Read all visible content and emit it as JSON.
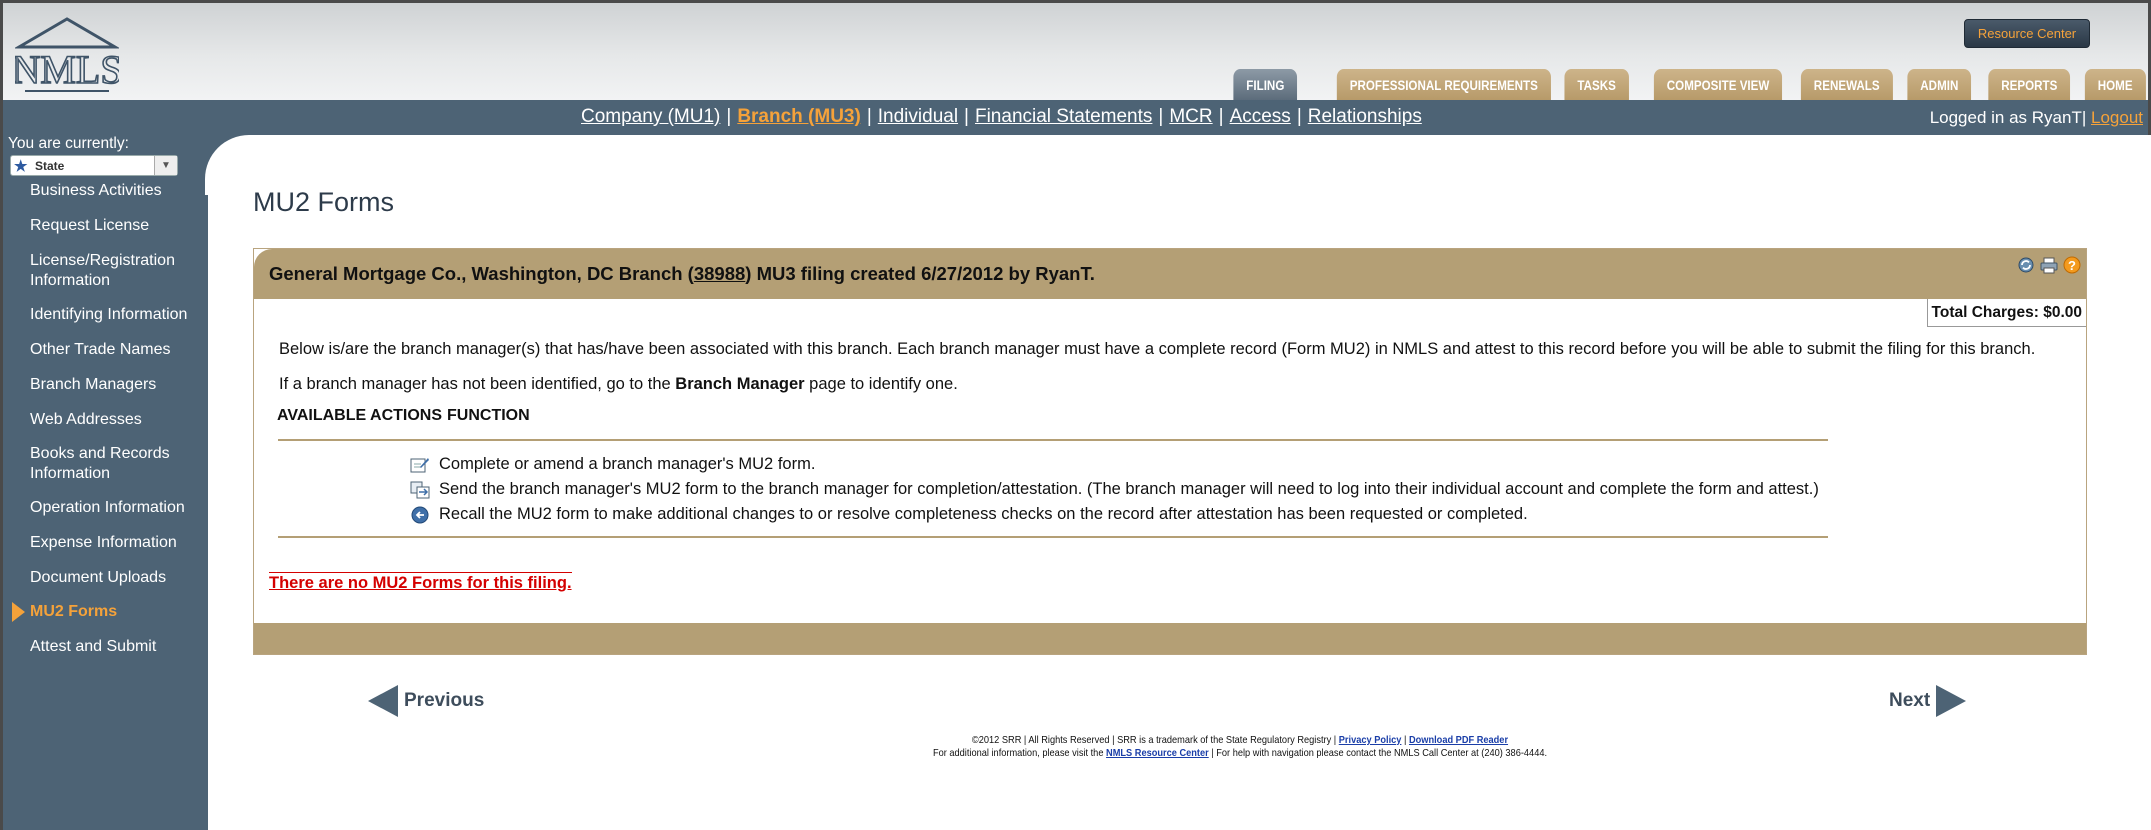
{
  "header": {
    "logo_text": "NMLS",
    "resource_center": "Resource Center",
    "tabs": [
      "FILING",
      "PROFESSIONAL REQUIREMENTS",
      "TASKS",
      "COMPOSITE VIEW",
      "RENEWALS",
      "ADMIN",
      "REPORTS",
      "HOME"
    ],
    "active_tab": "FILING"
  },
  "nav": {
    "links": [
      "Company (MU1)",
      "Branch (MU3)",
      "Individual",
      "Financial Statements",
      "MCR",
      "Access",
      "Relationships"
    ],
    "current": "Branch (MU3)",
    "separator": "|",
    "logged_in": "Logged in as RyanT",
    "logout": "Logout"
  },
  "sidebar": {
    "you_are": "You are currently:",
    "state_label": "State",
    "items": [
      "Business Activities",
      "Request License",
      "License/Registration Information",
      "Identifying Information",
      "Other Trade Names",
      "Branch Managers",
      "Web Addresses",
      "Books and Records Information",
      "Operation Information",
      "Expense Information",
      "Document Uploads",
      "MU2 Forms",
      "Attest and Submit"
    ],
    "active_item": "MU2 Forms"
  },
  "main": {
    "title": "MU2 Forms",
    "filing_prefix": "General Mortgage Co., Washington, DC Branch (",
    "filing_id": "38988",
    "filing_suffix": ") MU3 filing created 6/27/2012 by RyanT.",
    "total_charges": "Total Charges: $0.00",
    "para1": "Below is/are the branch manager(s) that has/have been associated with this branch. Each branch manager must have a complete record (Form MU2) in NMLS and attest to this record before you will be able to submit the filing for this branch.",
    "para2_prefix": "If a branch manager has not been identified, go to the ",
    "para2_bold": "Branch Manager",
    "para2_suffix": " page to identify one.",
    "col_actions": "AVAILABLE ACTIONS",
    "col_function": "FUNCTION",
    "actions": [
      {
        "icon": "edit-icon",
        "text": "Complete or amend a branch manager's MU2 form."
      },
      {
        "icon": "send-icon",
        "text": "Send the branch manager's MU2 form to the branch manager for completion/attestation. (The branch manager will need to log into their individual account and complete the form and attest.)"
      },
      {
        "icon": "recall-icon",
        "text": "Recall the MU2 form to make additional changes to or resolve completeness checks on the record after attestation has been requested or completed."
      }
    ],
    "empty_message": "There are no MU2 Forms for this filing.",
    "header_icons": [
      "refresh-icon",
      "print-icon",
      "help-icon"
    ]
  },
  "pager": {
    "previous": "Previous",
    "next": "Next"
  },
  "footer": {
    "line1_prefix": "©2012 SRR | All Rights Reserved | SRR is a trademark of the State Regulatory Registry | ",
    "privacy": "Privacy Policy",
    "sep": " | ",
    "pdf": "Download PDF Reader",
    "line2_prefix": "For additional information, please visit the ",
    "resource": "NMLS Resource Center",
    "line2_suffix": " | For help with navigation please contact the NMLS Call Center at (240) 386-4444."
  },
  "colors": {
    "nav_bg": "#4d6375",
    "accent_orange": "#f5a23a",
    "tab_tan": "#b79a69",
    "panel_tan": "#b49f75",
    "error_red": "#d40000"
  }
}
